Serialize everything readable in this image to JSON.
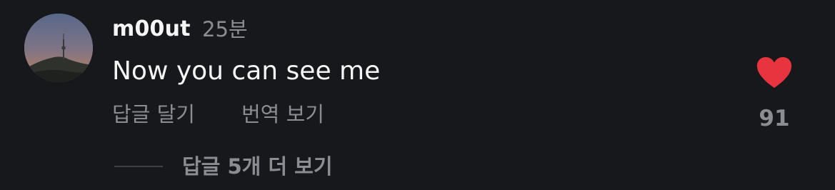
{
  "comment": {
    "username": "m00ut",
    "timestamp": "25분",
    "text": "Now you can see me",
    "reply_label": "답글 달기",
    "translate_label": "번역 보기",
    "like_count": "91",
    "more_replies_label": "답글 5개 더 보기"
  },
  "icons": {
    "like": "heart-icon",
    "avatar": "avatar-image"
  },
  "colors": {
    "background": "#17181c",
    "primary_text": "#f5f5f5",
    "secondary_text": "#8b8d93",
    "heart": "#e8343f",
    "divider": "#3e4046"
  }
}
